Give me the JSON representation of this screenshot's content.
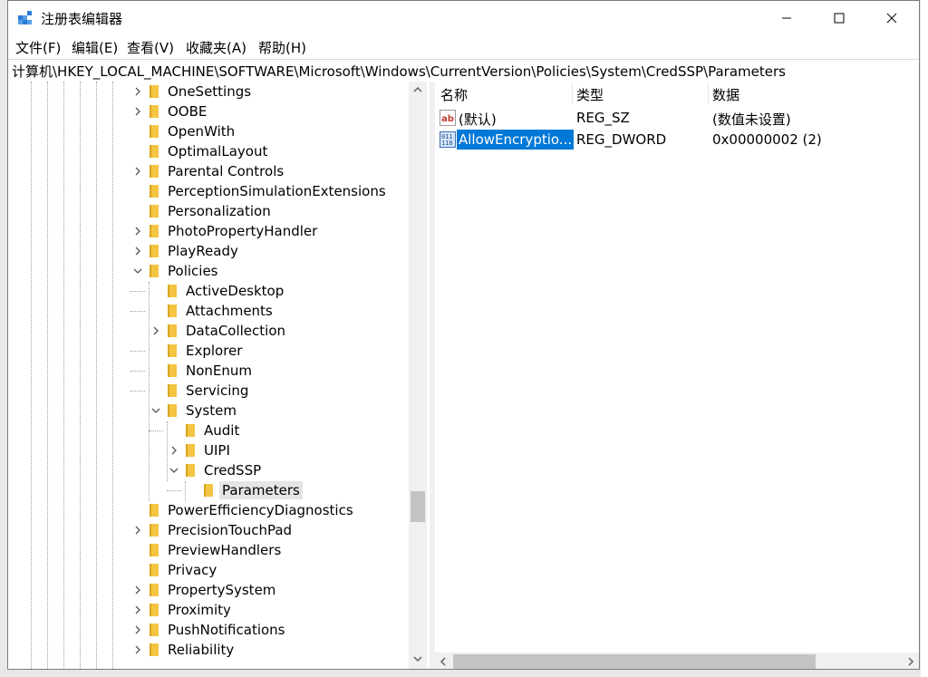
{
  "window": {
    "title": "注册表编辑器"
  },
  "menu": [
    "文件(F)",
    "编辑(E)",
    "查看(V)",
    "收藏夹(A)",
    "帮助(H)"
  ],
  "address": "计算机\\HKEY_LOCAL_MACHINE\\SOFTWARE\\Microsoft\\Windows\\CurrentVersion\\Policies\\System\\CredSSP\\Parameters",
  "tree": {
    "items": [
      {
        "label": "OneSettings",
        "level": 0,
        "exp": "collapsed"
      },
      {
        "label": "OOBE",
        "level": 0,
        "exp": "collapsed"
      },
      {
        "label": "OpenWith",
        "level": 0,
        "exp": "none"
      },
      {
        "label": "OptimalLayout",
        "level": 0,
        "exp": "none"
      },
      {
        "label": "Parental Controls",
        "level": 0,
        "exp": "collapsed"
      },
      {
        "label": "PerceptionSimulationExtensions",
        "level": 0,
        "exp": "none"
      },
      {
        "label": "Personalization",
        "level": 0,
        "exp": "none"
      },
      {
        "label": "PhotoPropertyHandler",
        "level": 0,
        "exp": "collapsed"
      },
      {
        "label": "PlayReady",
        "level": 0,
        "exp": "collapsed"
      },
      {
        "label": "Policies",
        "level": 0,
        "exp": "expanded"
      },
      {
        "label": "ActiveDesktop",
        "level": 1,
        "exp": "none"
      },
      {
        "label": "Attachments",
        "level": 1,
        "exp": "none"
      },
      {
        "label": "DataCollection",
        "level": 1,
        "exp": "collapsed"
      },
      {
        "label": "Explorer",
        "level": 1,
        "exp": "none"
      },
      {
        "label": "NonEnum",
        "level": 1,
        "exp": "none"
      },
      {
        "label": "Servicing",
        "level": 1,
        "exp": "none"
      },
      {
        "label": "System",
        "level": 1,
        "exp": "expanded"
      },
      {
        "label": "Audit",
        "level": 2,
        "exp": "none"
      },
      {
        "label": "UIPI",
        "level": 2,
        "exp": "collapsed"
      },
      {
        "label": "CredSSP",
        "level": 2,
        "exp": "expanded"
      },
      {
        "label": "Parameters",
        "level": 3,
        "exp": "none",
        "selected": true
      },
      {
        "label": "PowerEfficiencyDiagnostics",
        "level": 0,
        "exp": "none"
      },
      {
        "label": "PrecisionTouchPad",
        "level": 0,
        "exp": "collapsed"
      },
      {
        "label": "PreviewHandlers",
        "level": 0,
        "exp": "none"
      },
      {
        "label": "Privacy",
        "level": 0,
        "exp": "none"
      },
      {
        "label": "PropertySystem",
        "level": 0,
        "exp": "collapsed"
      },
      {
        "label": "Proximity",
        "level": 0,
        "exp": "collapsed"
      },
      {
        "label": "PushNotifications",
        "level": 0,
        "exp": "collapsed"
      },
      {
        "label": "Reliability",
        "level": 0,
        "exp": "collapsed"
      }
    ]
  },
  "list": {
    "columns": [
      "名称",
      "类型",
      "数据"
    ],
    "rows": [
      {
        "icon": "string-value-icon",
        "name": "(默认)",
        "type": "REG_SZ",
        "data": "(数值未设置)",
        "selected": false
      },
      {
        "icon": "binary-value-icon",
        "name": "AllowEncryptio...",
        "type": "REG_DWORD",
        "data": "0x00000002 (2)",
        "selected": true
      }
    ]
  },
  "colors": {
    "selection": "#0078d7",
    "folder": "#f4c542",
    "tree_selected": "#e5e5e5"
  }
}
